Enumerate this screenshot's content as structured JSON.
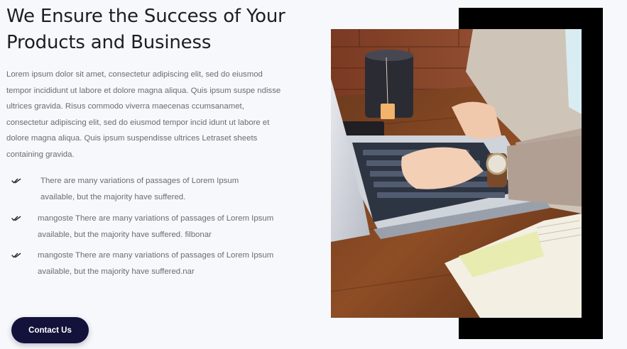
{
  "section": {
    "title": "We Ensure the Success of Your Products and Business",
    "intro": "Lorem ipsum dolor sit amet, consectetur adipiscing elit, sed do eiusmod tempor incididunt ut labore et dolore magna aliqua. Quis ipsum suspe ndisse ultrices gravida. Risus commodo viverra maecenas ccumsanamet, consectetur adipiscing elit, sed do eiusmod tempor incid idunt ut labore et dolore magna aliqua. Quis ipsum suspendisse ultrices Letraset sheets containing gravida.",
    "checklist": [
      {
        "icon": "double-check-icon",
        "text": "There are many variations of passages of Lorem Ipsum available, but the majority have suffered."
      },
      {
        "icon": "double-check-icon",
        "text": "mangoste There are many variations of passages of Lorem Ipsum available, but the majority have suffered. filbonar"
      },
      {
        "icon": "double-check-icon",
        "text": "mangoste There are many variations of passages of Lorem Ipsum available, but the majority have suffered.nar"
      }
    ],
    "cta_label": "Contact Us"
  },
  "colors": {
    "background": "#f7f8fb",
    "heading": "#1d1d26",
    "body_text": "#6a6b78",
    "button": "#13123a",
    "frame_block": "#000000"
  }
}
